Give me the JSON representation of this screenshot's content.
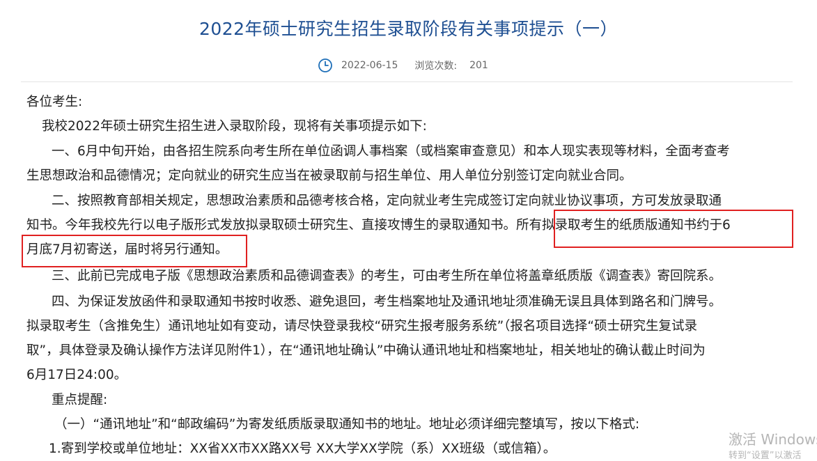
{
  "article": {
    "title": "2022年硕士研究生招生录取阶段有关事项提示（一）",
    "date": "2022-06-15",
    "views_label": "浏览次数:",
    "views": "201"
  },
  "body": {
    "greeting": "各位考生:",
    "intro": "我校2022年硕士研究生招生进入录取阶段，现将有关事项提示如下:",
    "p1_line1": "一、6月中旬开始，由各招生院系向考生所在单位函调人事档案（或档案审查意见）和本人现实表现等材料，全面考查考",
    "p1_line2": "生思想政治和品德情况；定向就业的研究生应当在被录取前与招生单位、用人单位分别签订定向就业合同。",
    "p2_line1": "二、按照教育部相关规定，思想政治素质和品德考核合格，定向就业考生完成签订定向就业协议事项，方可发放录取通",
    "p2_line2": "知书。今年我校先行以电子版形式发放拟录取硕士研究生、直接攻博生的录取通知书。所有拟录取考生的纸质版通知书约于6",
    "p2_line3": "月底7月初寄送，届时将另行通知。",
    "p3_line1": "三、此前已完成电子版《思想政治素质和品德调查表》的考生，可由考生所在单位将盖章纸质版《调查表》寄回院系。",
    "p4_line1": "四、为保证发放函件和录取通知书按时收悉、避免退回，考生档案地址及通讯地址须准确无误且具体到路名和门牌号。",
    "p4_line2": "拟录取考生（含推免生）通讯地址如有变动，请尽快登录我校“研究生报考服务系统”（报名项目选择“硕士研究生复试录",
    "p4_line3": "取”，具体登录及确认操作方法详见附件1），在“通讯地址确认”中确认通讯地址和档案地址，相关地址的确认截止时间为",
    "p4_line4": "6月17日24:00。",
    "key_heading": "重点提醒:",
    "key_item1": "（一）“通讯地址”和“邮政编码”为寄发纸质版录取通知书的地址。地址必须详细完整填写，按以下格式:",
    "key_sub1": "1.寄到学校或单位地址：XX省XX市XX路XX号 XX大学XX学院（系）XX班级（或信箱）。"
  },
  "watermark": {
    "line1": "激活 Windows",
    "line2": "转到“设置”以激活"
  },
  "colors": {
    "title": "#1e4f92",
    "highlight_box": "#e02020",
    "meta_text": "#666666"
  },
  "icons": {
    "meta": "clock-icon"
  }
}
